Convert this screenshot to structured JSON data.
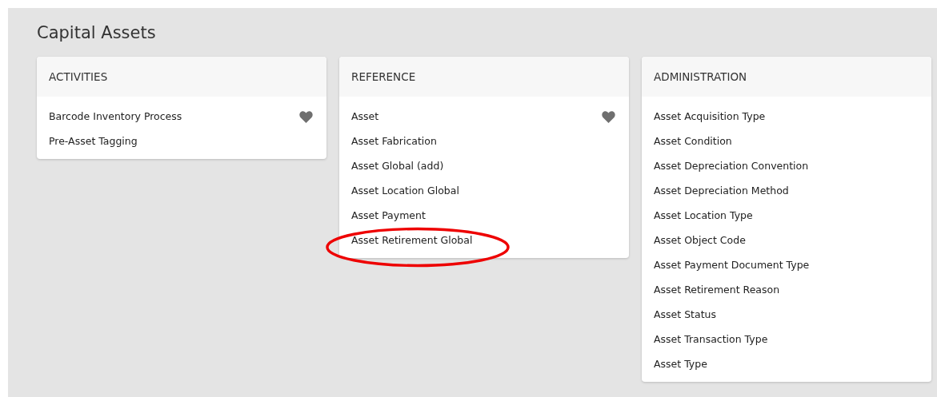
{
  "page": {
    "title": "Capital Assets"
  },
  "panels": [
    {
      "heading": "ACTIVITIES",
      "items": [
        {
          "label": "Barcode Inventory Process",
          "favorite": true,
          "circled": false
        },
        {
          "label": "Pre-Asset Tagging",
          "favorite": false,
          "circled": false
        }
      ]
    },
    {
      "heading": "REFERENCE",
      "items": [
        {
          "label": "Asset",
          "favorite": true,
          "circled": false
        },
        {
          "label": "Asset Fabrication",
          "favorite": false,
          "circled": false
        },
        {
          "label": "Asset Global (add)",
          "favorite": false,
          "circled": false
        },
        {
          "label": "Asset Location Global",
          "favorite": false,
          "circled": false
        },
        {
          "label": "Asset Payment",
          "favorite": false,
          "circled": false
        },
        {
          "label": "Asset Retirement Global",
          "favorite": false,
          "circled": true
        }
      ]
    },
    {
      "heading": "ADMINISTRATION",
      "items": [
        {
          "label": "Asset Acquisition Type",
          "favorite": false,
          "circled": false
        },
        {
          "label": "Asset Condition",
          "favorite": false,
          "circled": false
        },
        {
          "label": "Asset Depreciation Convention",
          "favorite": false,
          "circled": false
        },
        {
          "label": "Asset Depreciation Method",
          "favorite": false,
          "circled": false
        },
        {
          "label": "Asset Location Type",
          "favorite": false,
          "circled": false
        },
        {
          "label": "Asset Object Code",
          "favorite": false,
          "circled": false
        },
        {
          "label": "Asset Payment Document Type",
          "favorite": false,
          "circled": false
        },
        {
          "label": "Asset Retirement Reason",
          "favorite": false,
          "circled": false
        },
        {
          "label": "Asset Status",
          "favorite": false,
          "circled": false
        },
        {
          "label": "Asset Transaction Type",
          "favorite": false,
          "circled": false
        },
        {
          "label": "Asset Type",
          "favorite": false,
          "circled": false
        }
      ]
    }
  ]
}
